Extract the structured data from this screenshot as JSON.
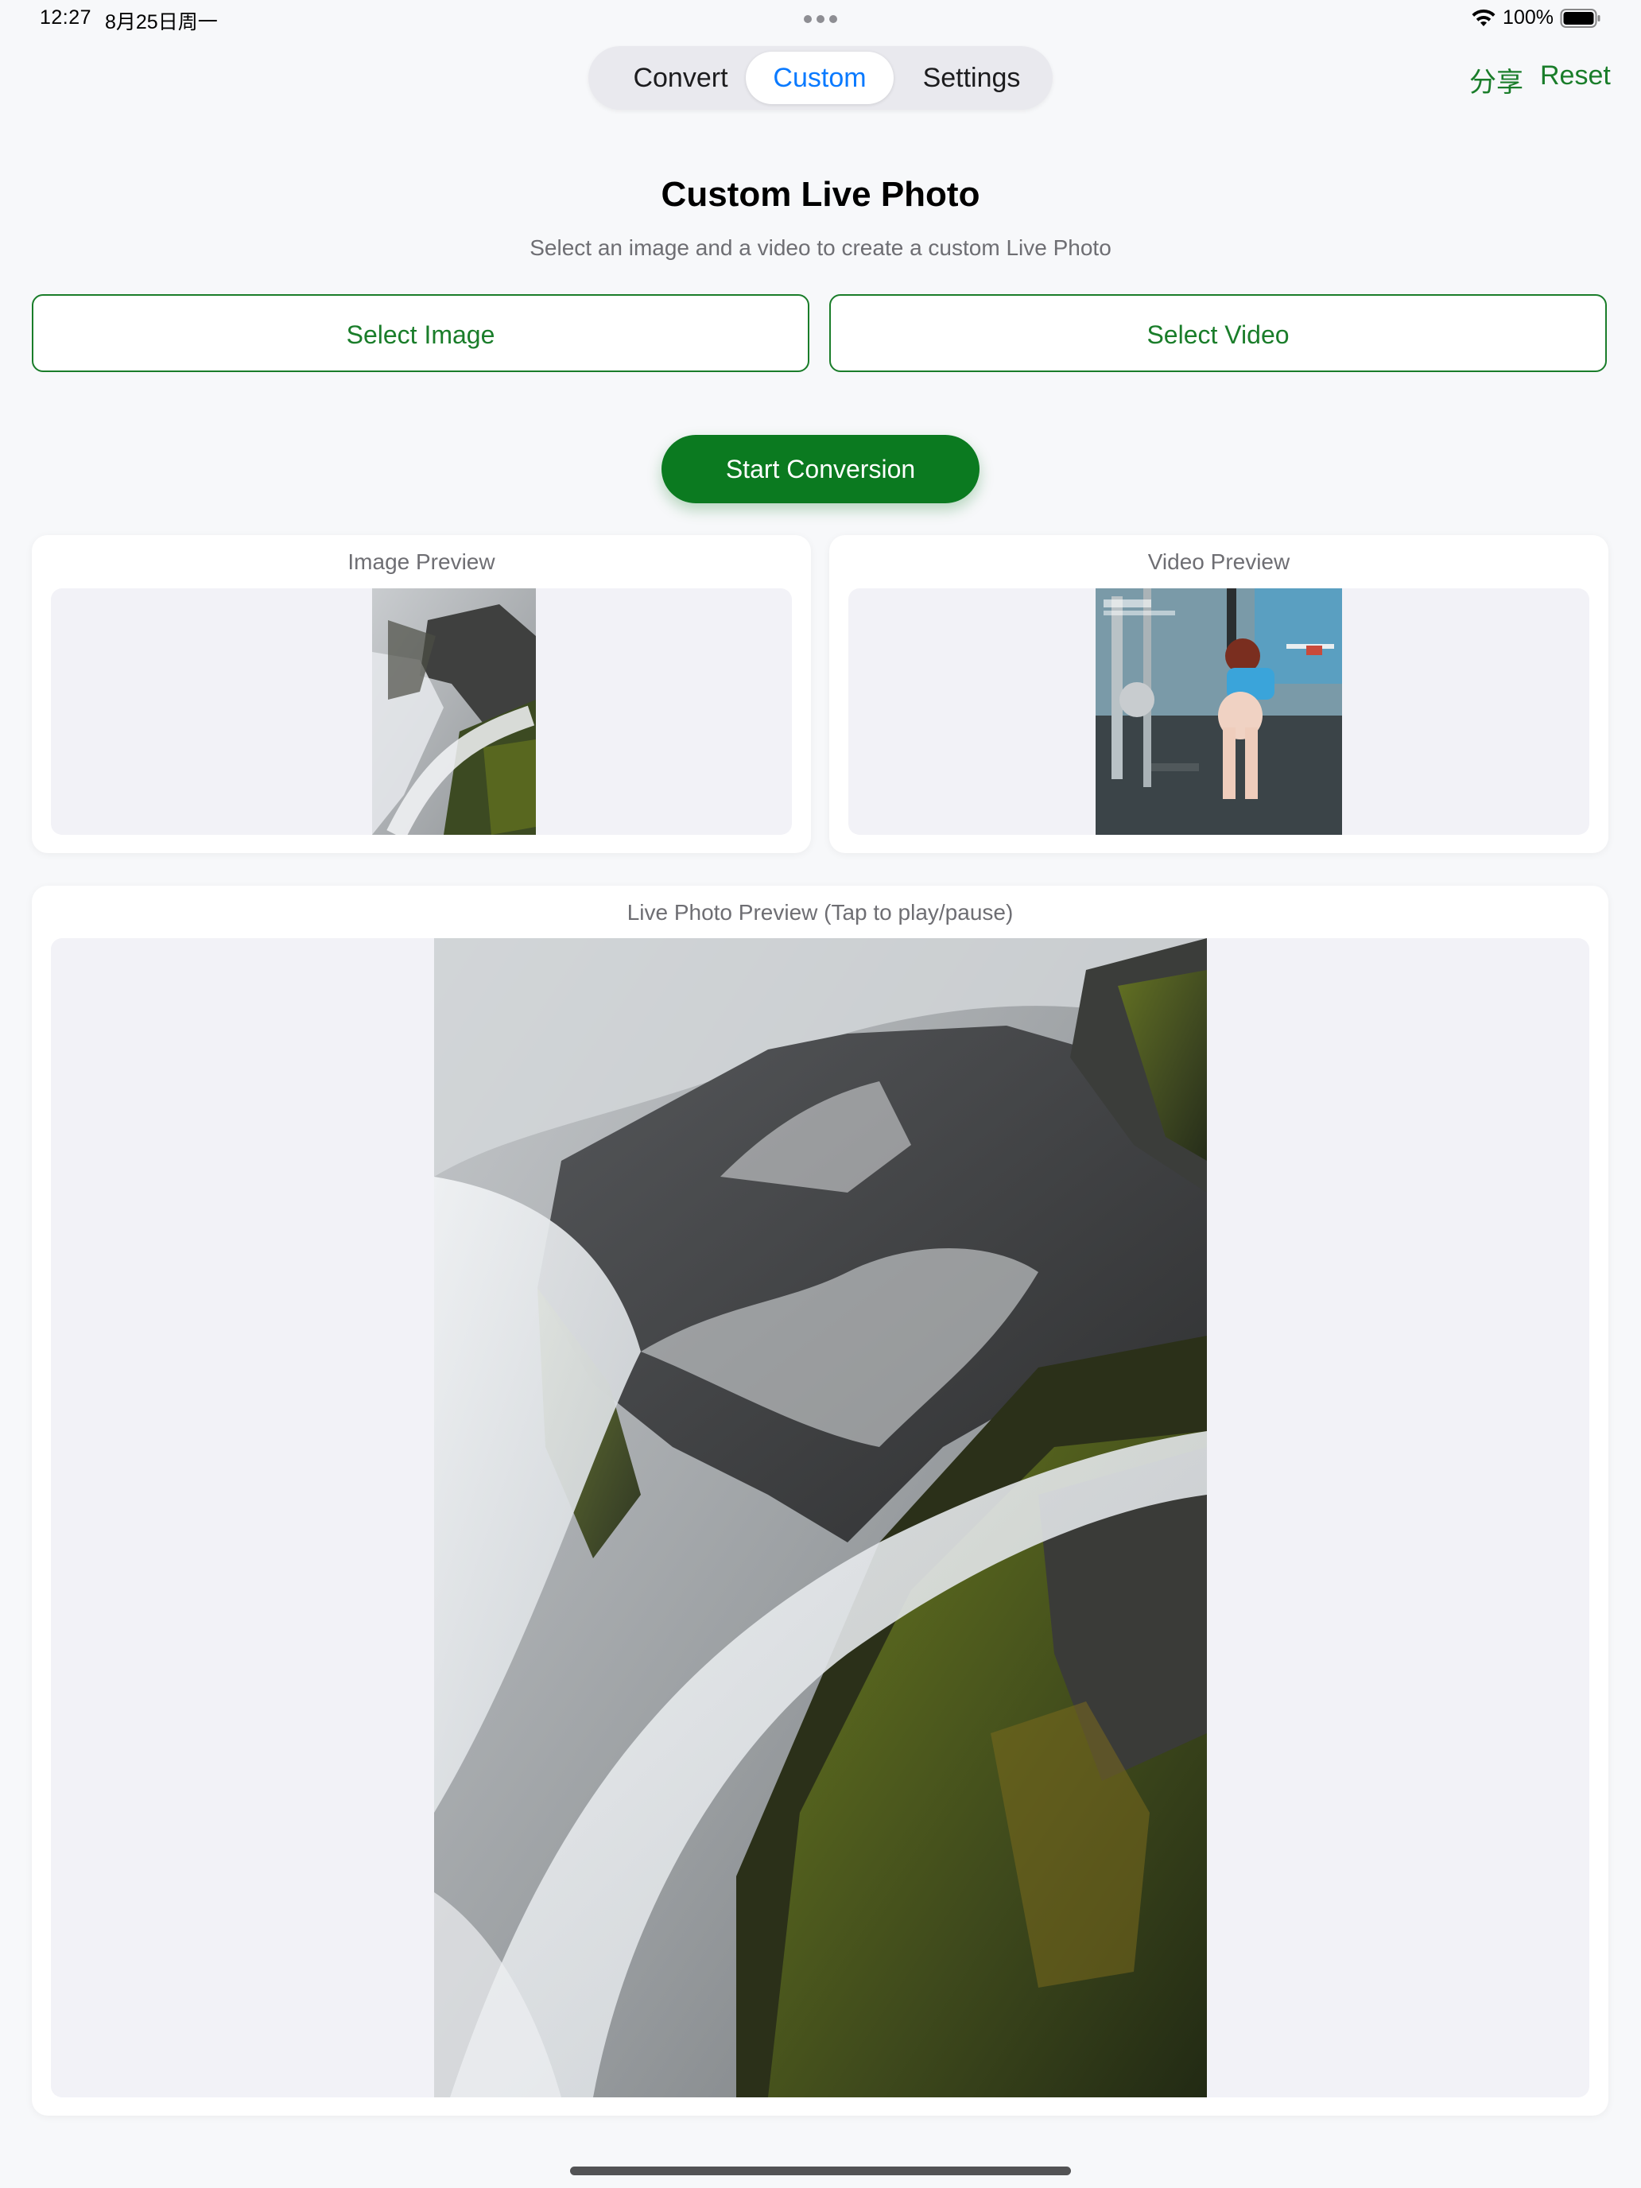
{
  "status_bar": {
    "time": "12:27",
    "date": "8月25日周一",
    "battery_percent": "100%"
  },
  "segmented": {
    "items": [
      {
        "label": "Convert",
        "selected": false
      },
      {
        "label": "Custom",
        "selected": true
      },
      {
        "label": "Settings",
        "selected": false
      }
    ]
  },
  "nav_actions": {
    "share_label": "分享",
    "reset_label": "Reset"
  },
  "header": {
    "title": "Custom Live Photo",
    "subtitle": "Select an image and a video to create a custom Live Photo"
  },
  "buttons": {
    "select_image": "Select Image",
    "select_video": "Select Video",
    "start_conversion": "Start Conversion"
  },
  "previews": {
    "image_label": "Image Preview",
    "video_label": "Video Preview",
    "live_label": "Live Photo Preview (Tap to play/pause)"
  },
  "colors": {
    "accent_green": "#1a7d2a",
    "primary_button": "#0b7a20",
    "selected_tab_text": "#0a7aff",
    "background": "#f7f8fa"
  },
  "icons": {
    "wifi": "wifi-icon",
    "battery": "battery-icon",
    "multitask": "multitask-dots-icon"
  }
}
